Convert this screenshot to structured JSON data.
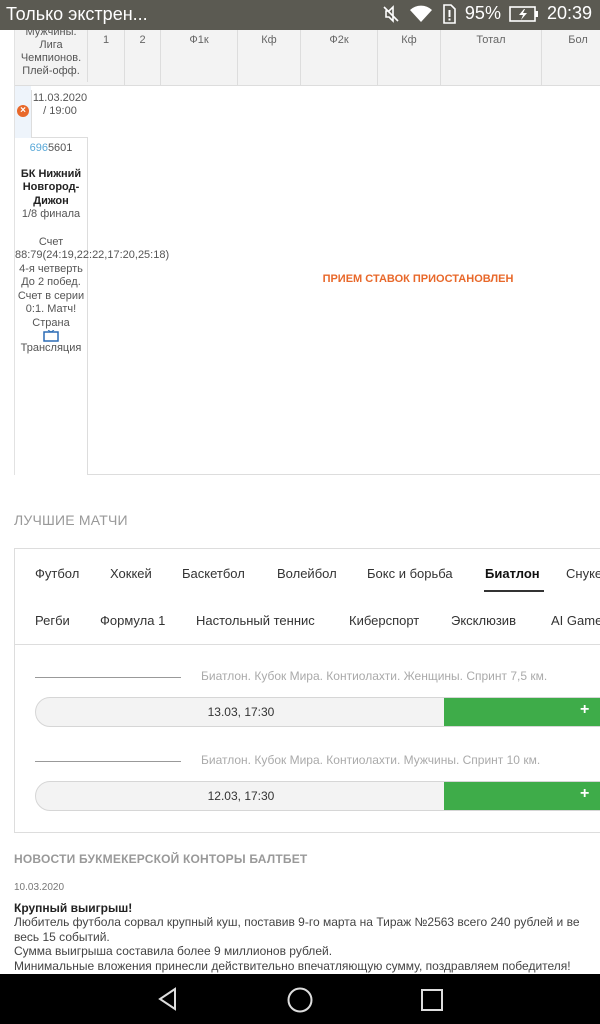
{
  "statusbar": {
    "notification": "Только экстрен...",
    "battery_pct": "95%",
    "time": "20:39",
    "icons": [
      "mute-icon",
      "wifi-icon",
      "sim-alert-icon",
      "battery-charging-icon"
    ]
  },
  "table": {
    "first_col_header": "Мужчины. Лига Чемпионов. Плей-офф.",
    "columns": [
      "1",
      "2",
      "Ф1к",
      "Кф",
      "Ф2к",
      "Кф",
      "Тотал",
      "Бол"
    ],
    "date": "11.03.2020 / 19:00",
    "match_id_prefix": "696",
    "match_id_rest": "5601",
    "team": "БК Нижний Новгород-Дижон",
    "stage": "1/8 финала",
    "score_info": "Счет 88:79(24:19,22:22,17:20,25:18) 4-я четверть До 2 побед. Счет в серии 0:1. Матч! Страна",
    "broadcast": "Трансляция",
    "suspended": "ПРИЕМ СТАВОК ПРИОСТАНОВЛЕН"
  },
  "best_matches": {
    "title": "ЛУЧШИЕ МАТЧИ",
    "tabs_row1": [
      "Футбол",
      "Хоккей",
      "Баскетбол",
      "Волейбол",
      "Бокс и борьба",
      "Биатлон",
      "Снукер"
    ],
    "tabs_row2": [
      "Регби",
      "Формула 1",
      "Настольный теннис",
      "Киберспорт",
      "Эксклюзив",
      "AI Games"
    ],
    "active_tab": "Биатлон",
    "events": [
      {
        "name": "Биатлон. Кубок Мира. Контиолахти. Женщины. Спринт 7,5 км.",
        "datetime": "13.03, 17:30",
        "plus": "+"
      },
      {
        "name": "Биатлон. Кубок Мира. Контиолахти. Мужчины. Спринт 10 км.",
        "datetime": "12.03, 17:30",
        "plus": "+"
      }
    ]
  },
  "news": {
    "title": "НОВОСТИ БУКМЕКЕРСКОЙ КОНТОРЫ БАЛТБЕТ",
    "date": "10.03.2020",
    "headline": "Крупный выигрыш!",
    "lines": [
      "Любитель футбола сорвал крупный куш, поставив 9-го марта на Тираж №2563 всего 240 рублей и ве",
      "весь 15 событий.",
      "Сумма выигрыша составила более 9 миллионов рублей.",
      "Минимальные вложения принесли действительно впечатляющую сумму, поздравляем победителя!"
    ]
  },
  "navbar": {
    "icons": [
      "back-icon",
      "home-icon",
      "recents-icon"
    ]
  }
}
